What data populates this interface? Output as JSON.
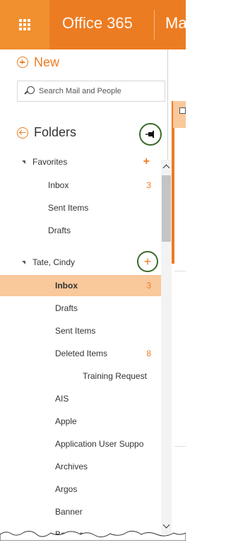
{
  "topbar": {
    "brand": "Office 365",
    "app_name": "Ma"
  },
  "new_button": {
    "label": "New"
  },
  "search": {
    "placeholder": "Search Mail and People"
  },
  "folders": {
    "header": "Folders",
    "favorites": {
      "label": "Favorites",
      "items": [
        {
          "label": "Inbox",
          "count": "3"
        },
        {
          "label": "Sent Items",
          "count": ""
        },
        {
          "label": "Drafts",
          "count": ""
        }
      ]
    },
    "account": {
      "label": "Tate, Cindy",
      "items": [
        {
          "label": "Inbox",
          "count": "3",
          "selected": true
        },
        {
          "label": "Drafts",
          "count": ""
        },
        {
          "label": "Sent Items",
          "count": ""
        },
        {
          "label": "Deleted Items",
          "count": "8"
        },
        {
          "label": "Training Request",
          "count": ""
        },
        {
          "label": "AIS",
          "count": ""
        },
        {
          "label": "Apple",
          "count": ""
        },
        {
          "label": "Application User Suppo",
          "count": ""
        },
        {
          "label": "Archives",
          "count": ""
        },
        {
          "label": "Argos",
          "count": ""
        },
        {
          "label": "Banner",
          "count": ""
        },
        {
          "label": "Banner",
          "count": ""
        }
      ]
    }
  },
  "add_symbol": "+",
  "colors": {
    "accent": "#ec7c22",
    "selected_bg": "#f9c89b",
    "highlight_ring": "#3d6b2a"
  }
}
